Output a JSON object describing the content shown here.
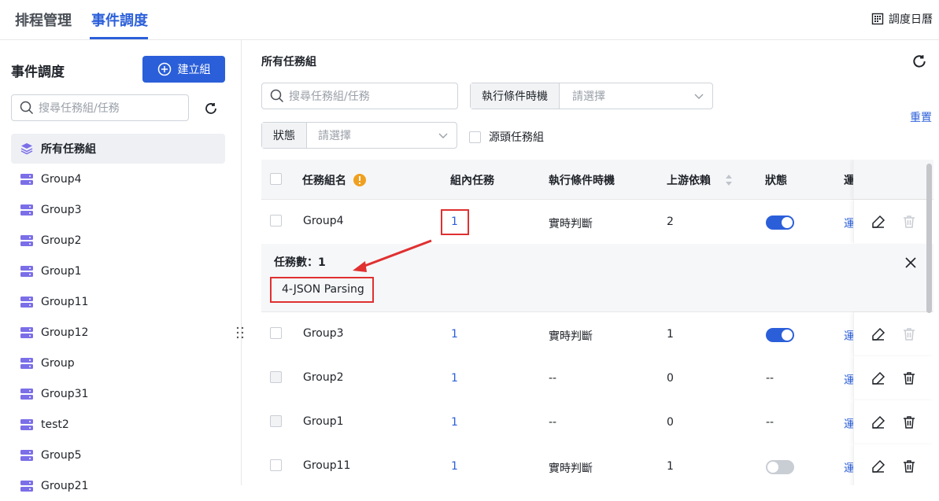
{
  "top_tabs": [
    {
      "label": "排程管理",
      "active": false
    },
    {
      "label": "事件調度",
      "active": true
    }
  ],
  "calendar_label": "調度日曆",
  "sidebar": {
    "title": "事件調度",
    "create_button": "建立組",
    "search_placeholder": "搜尋任務組/任務",
    "items": [
      {
        "label": "所有任務組",
        "active": true
      },
      {
        "label": "Group4"
      },
      {
        "label": "Group3"
      },
      {
        "label": "Group2"
      },
      {
        "label": "Group1"
      },
      {
        "label": "Group11"
      },
      {
        "label": "Group12"
      },
      {
        "label": "Group"
      },
      {
        "label": "Group31"
      },
      {
        "label": "test2"
      },
      {
        "label": "Group5"
      },
      {
        "label": "Group21"
      }
    ]
  },
  "main": {
    "title": "所有任務組",
    "search_placeholder": "搜尋任務組/任務",
    "filter_timing_label": "執行條件時機",
    "filter_timing_placeholder": "請選擇",
    "filter_status_label": "狀態",
    "filter_status_placeholder": "請選擇",
    "source_group_label": "源頭任務組",
    "reset_label": "重置"
  },
  "table": {
    "headers": {
      "name": "任務組名",
      "tasks": "組內任務",
      "timing": "執行條件時機",
      "upstream": "上游依賴",
      "status": "狀態",
      "ops": "運"
    },
    "rows": [
      {
        "name": "Group4",
        "tasks": "1",
        "timing": "實時判斷",
        "upstream": "2",
        "status": "on",
        "ops": "運"
      },
      {
        "name": "Group3",
        "tasks": "1",
        "timing": "實時判斷",
        "upstream": "1",
        "status": "on",
        "ops": "運"
      },
      {
        "name": "Group2",
        "tasks": "1",
        "timing": "--",
        "upstream": "0",
        "status": "--",
        "ops": "運"
      },
      {
        "name": "Group1",
        "tasks": "1",
        "timing": "--",
        "upstream": "0",
        "status": "--",
        "ops": "運"
      },
      {
        "name": "Group11",
        "tasks": "1",
        "timing": "實時判斷",
        "upstream": "1",
        "status": "off",
        "ops": "運"
      }
    ],
    "expand": {
      "count_label": "任務數：1",
      "task_name": "4-JSON Parsing"
    }
  },
  "colors": {
    "accent": "#2b5fd9",
    "highlight": "#e03030",
    "warning": "#f0a020"
  },
  "icons": [
    "calendar-icon",
    "plus-circle-icon",
    "search-icon",
    "refresh-icon",
    "layers-icon",
    "group-icon",
    "drag-handle-icon",
    "chevron-down-icon",
    "info-icon",
    "sort-icon",
    "edit-icon",
    "delete-icon",
    "close-icon"
  ]
}
